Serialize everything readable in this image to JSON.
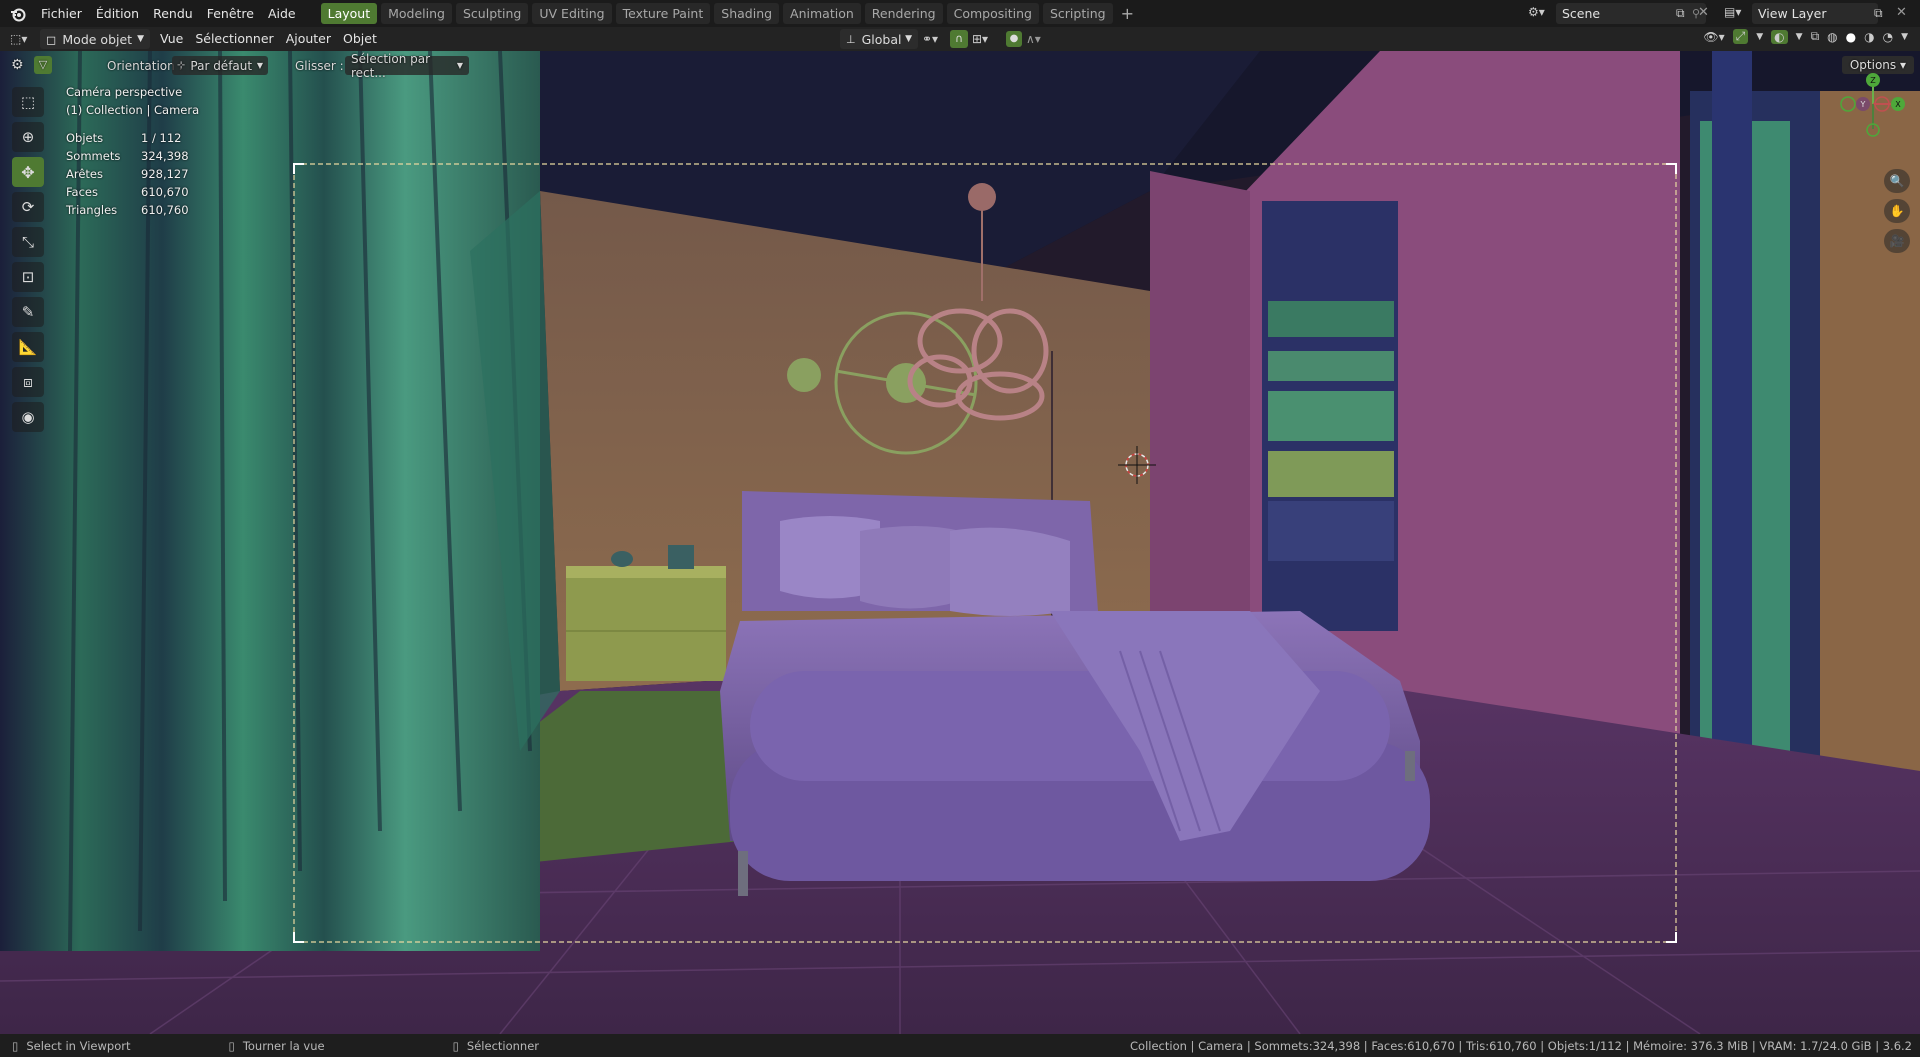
{
  "menu": [
    "Fichier",
    "Édition",
    "Rendu",
    "Fenêtre",
    "Aide"
  ],
  "workspaces": [
    "Layout",
    "Modeling",
    "Sculpting",
    "UV Editing",
    "Texture Paint",
    "Shading",
    "Animation",
    "Rendering",
    "Compositing",
    "Scripting"
  ],
  "active_workspace": "Layout",
  "scene_name": "Scene",
  "view_layer": "View Layer",
  "header": {
    "mode": "Mode objet",
    "menus": [
      "Vue",
      "Sélectionner",
      "Ajouter",
      "Objet"
    ],
    "transform_orientation": "Global"
  },
  "tool_options": {
    "orientation_label": "Orientation :",
    "orientation_value": "Par défaut",
    "drag_label": "Glisser :",
    "drag_value": "Sélection par rect..."
  },
  "options_button": "Options",
  "overlay": {
    "view_name": "Caméra perspective",
    "collection": "(1) Collection | Camera",
    "stats": [
      {
        "label": "Objets",
        "value": "1 / 112"
      },
      {
        "label": "Sommets",
        "value": "324,398"
      },
      {
        "label": "Arêtes",
        "value": "928,127"
      },
      {
        "label": "Faces",
        "value": "610,670"
      },
      {
        "label": "Triangles",
        "value": "610,760"
      }
    ]
  },
  "gizmo": {
    "z": "Z",
    "y": "Y",
    "x": "X"
  },
  "status": {
    "left1": "Select in Viewport",
    "left2": "Tourner la vue",
    "left3": "Sélectionner",
    "right": "Collection | Camera | Sommets:324,398 | Faces:610,670 | Tris:610,760 | Objets:1/112 | Mémoire: 376.3 MiB | VRAM: 1.7/24.0 GiB | 3.6.2"
  },
  "colors": {
    "accent": "#4f7a32",
    "wall": "#8a6a4e",
    "pink_wall": "#8e4e7e",
    "bed": "#7c63a8",
    "floor": "#50305a",
    "curtain": "#2f6b55"
  }
}
